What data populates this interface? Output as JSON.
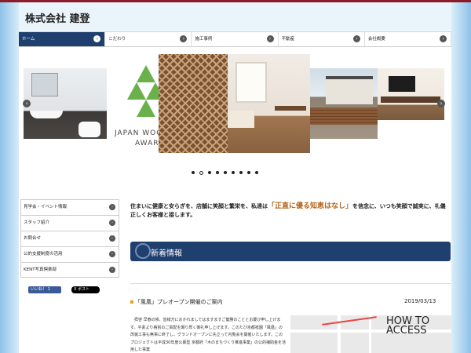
{
  "site": {
    "title": "株式会社 建登"
  },
  "nav": {
    "items": [
      {
        "label": "ホーム",
        "active": true
      },
      {
        "label": "こだわり"
      },
      {
        "label": "施工事例"
      },
      {
        "label": "不動産"
      },
      {
        "label": "会社概要"
      }
    ],
    "chevron": "›"
  },
  "slider": {
    "award_text_1": "JAPAN WOO",
    "award_text_2": "AWARD",
    "prev": "‹",
    "next": "›",
    "dot_count": 9,
    "active_index": 1
  },
  "sidebar": {
    "items": [
      {
        "label": "見学会・イベント情報"
      },
      {
        "label": "スタッフ紹介"
      },
      {
        "label": "お問合せ"
      },
      {
        "label": "公的支援制度の活用"
      },
      {
        "label": "KENT写真倶楽部"
      }
    ]
  },
  "share": {
    "facebook": "いいね！ 1",
    "twitter": "X ポスト"
  },
  "intro": {
    "before": "住まいに健康と安らぎを、店舗に笑顔と繁栄を、私達は",
    "highlight": "「正直に優る知恵はなし」",
    "after": "を信念に、いつも笑顔で誠実に、礼儀正しくお客様と接します。"
  },
  "news": {
    "title": "新着情報"
  },
  "entry": {
    "title": "「風凰」プレオープン開催のご案内",
    "date": "2019/03/13",
    "text": "　拝啓 早春の候、皆様方におかれましてはますますご健勝のこととお慶び申し上げます。平素より格別のご高配を賜り厚く御礼申し上げます。このたび京都祇園「風凰」の改装工事も無事に終了し、グランドオープンに先立って内覧会を開催いたします。このプロジェクトは平成30年度公募型 京都府「木のまちづくり推進事業」の公的補助金を活用した事業"
  },
  "map": {
    "how_to_1": "HOW TO",
    "how_to_2": "ACCESS"
  },
  "colors": {
    "nav_active": "#1f3f6f",
    "accent": "#b5651d",
    "topbar": "#8b1c2a"
  }
}
